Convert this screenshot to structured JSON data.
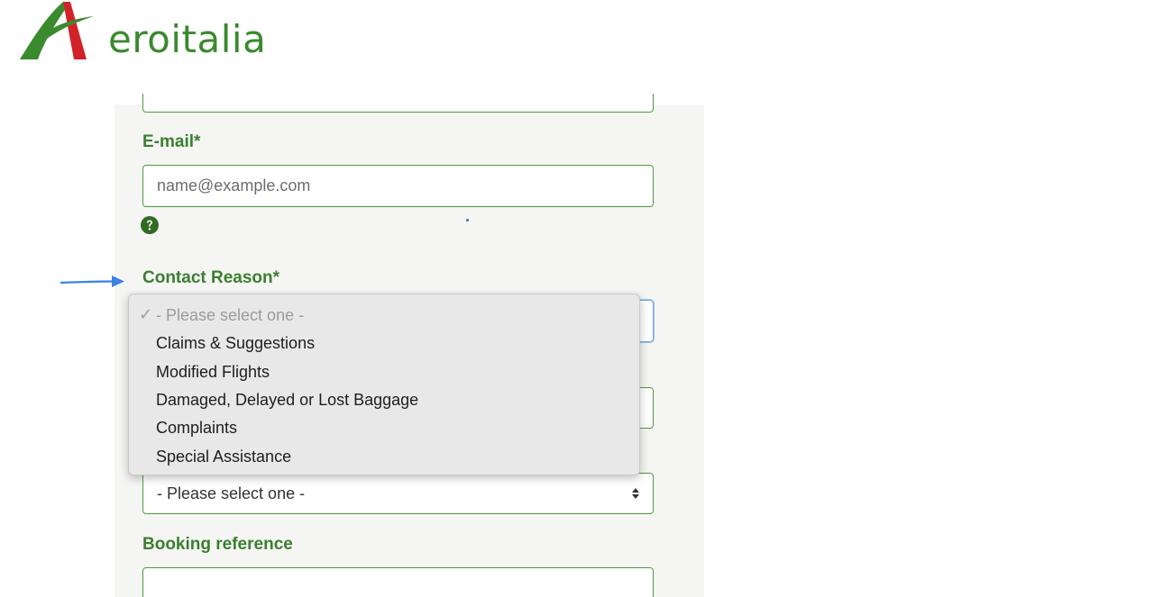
{
  "brand": {
    "name": "Aeroitalia",
    "logo_text": "eroitalia",
    "logo_green": "#3a8a2e",
    "logo_red": "#d2232a"
  },
  "form": {
    "email_label": "E-mail*",
    "email_placeholder": "name@example.com",
    "contact_reason_label": "Contact Reason*",
    "second_select_value": "- Please select one -",
    "booking_reference_label": "Booking reference"
  },
  "dropdown": {
    "selected": "- Please select one -",
    "options": [
      "Claims & Suggestions",
      "Modified Flights",
      "Damaged, Delayed or Lost Baggage",
      "Complaints",
      "Special Assistance"
    ]
  },
  "icons": {
    "help": "question-circle-icon",
    "check": "checkmark-icon",
    "pointer": "arrow-right-icon",
    "select_arrows": "select-arrows-icon"
  },
  "colors": {
    "label_green": "#3b7e30",
    "border_green": "#4e9a3f",
    "annotation_blue": "#3b82e6"
  }
}
